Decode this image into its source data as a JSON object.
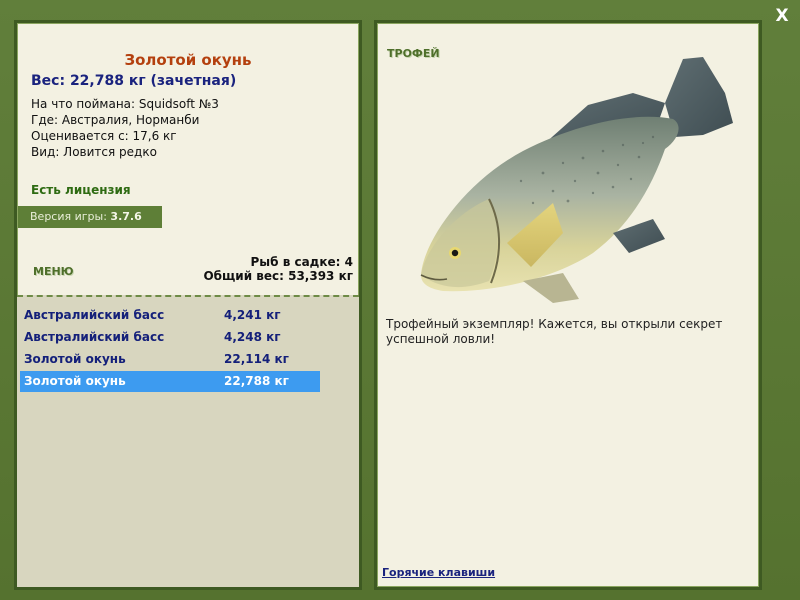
{
  "window": {
    "close_label": "X"
  },
  "fish": {
    "title": "Золотой окунь",
    "weight_line": "Вес: 22,788 кг (зачетная)",
    "caught_with": "На что поймана: Squidsoft №3",
    "location": "Где: Австралия, Норманби",
    "valued_from": "Оценивается с: 17,6 кг",
    "kind": "Вид: Ловится редко"
  },
  "license": {
    "text": "Есть лицензия"
  },
  "version": {
    "label": "Версия игры:",
    "number": "3.7.6"
  },
  "menu": {
    "label": "МЕНЮ"
  },
  "keepnet": {
    "count_text": "Рыб в садке: 4",
    "total_weight_text": "Общий вес: 53,393 кг",
    "rows": [
      {
        "name": "Австралийский басс",
        "weight": "4,241 кг",
        "selected": false
      },
      {
        "name": "Австралийский басс",
        "weight": "4,248 кг",
        "selected": false
      },
      {
        "name": "Золотой окунь",
        "weight": "22,114 кг",
        "selected": false
      },
      {
        "name": "Золотой окунь",
        "weight": "22,788 кг",
        "selected": true
      }
    ]
  },
  "trophy": {
    "label": "ТРОФЕЙ",
    "message": "Трофейный экземпляр! Кажется, вы открыли секрет успешной ловли!"
  },
  "footer": {
    "hotkeys_link": "Горячие клавиши"
  },
  "colors": {
    "frame_green": "#5b7a35",
    "panel_bg": "#f3f1e2",
    "title_orange": "#b4400e",
    "text_navy": "#1a237e",
    "selection_blue": "#3d9bf0"
  }
}
